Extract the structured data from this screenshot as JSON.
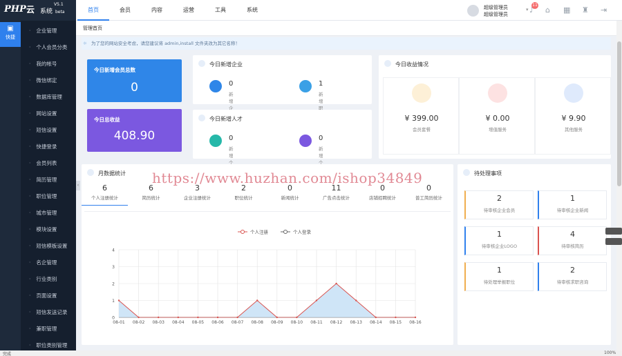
{
  "logo": {
    "php": "PHP",
    "yun": "云",
    "sys": "系统",
    "version": "V5.1",
    "beta": "beta"
  },
  "topnav": [
    "首页",
    "会员",
    "内容",
    "运营",
    "工具",
    "系统"
  ],
  "user": {
    "name": "超级管理员",
    "role": "超级管理员",
    "badge": "11"
  },
  "rail": {
    "label": "快捷"
  },
  "sidebar": [
    "企业管理",
    "个人会员分类",
    "我的帐号",
    "微信绑定",
    "数据库管理",
    "网站设置",
    "短信设置",
    "快捷登录",
    "会员列表",
    "简历管理",
    "职位管理",
    "城市管理",
    "模块设置",
    "短信模板设置",
    "名企管理",
    "行业类别",
    "页面设置",
    "短信发送记录",
    "兼职管理",
    "职位类别管理"
  ],
  "breadcrumb": "管理首页",
  "notice": "为了您的网站安全考虑，请您建议将 admin,install 文件夹改为其它名称！",
  "today_member_total": {
    "label": "今日新增会员总数",
    "value": "0"
  },
  "today_income": {
    "label": "今日总收益",
    "value": "408.90"
  },
  "new_companies": {
    "title": "今日新增企业",
    "items": [
      {
        "value": "0",
        "label": "新增企业会员"
      },
      {
        "value": "1",
        "label": "新增职位"
      }
    ]
  },
  "new_talents": {
    "title": "今日新增人才",
    "items": [
      {
        "value": "0",
        "label": "新增个人会员"
      },
      {
        "value": "0",
        "label": "新增个人简历"
      }
    ]
  },
  "income": {
    "title": "今日收益情况",
    "items": [
      {
        "value": "¥ 399.00",
        "label": "会员套餐"
      },
      {
        "value": "¥ 0.00",
        "label": "增值服务"
      },
      {
        "value": "¥ 9.90",
        "label": "其他服务"
      }
    ]
  },
  "monthly": {
    "title": "月数据统计",
    "tabs": [
      {
        "value": "6",
        "label": "个人注册统计"
      },
      {
        "value": "6",
        "label": "简历统计"
      },
      {
        "value": "3",
        "label": "企业注册统计"
      },
      {
        "value": "2",
        "label": "职位统计"
      },
      {
        "value": "0",
        "label": "新闻统计"
      },
      {
        "value": "11",
        "label": "广告点击统计"
      },
      {
        "value": "0",
        "label": "店铺招聘统计"
      },
      {
        "value": "0",
        "label": "普工简历统计"
      }
    ]
  },
  "todo": {
    "title": "待处理事项",
    "items": [
      {
        "value": "2",
        "label": "待审核企业会员"
      },
      {
        "value": "1",
        "label": "待审核企业新闻"
      },
      {
        "value": "1",
        "label": "待审核企业LOGO"
      },
      {
        "value": "4",
        "label": "待审核简历"
      },
      {
        "value": "1",
        "label": "待处理举报职位"
      },
      {
        "value": "2",
        "label": "待审核求职咨询"
      }
    ]
  },
  "watermark": "https://www.huzhan.com/ishop34849",
  "statusbar": {
    "text": "完成",
    "zoom": "100%"
  },
  "colors": {
    "accent": "#2f80ed",
    "sidebar": "#151f2e",
    "register": "#d9534f",
    "login": "#666666"
  },
  "chart_data": {
    "type": "line",
    "x": [
      "08-01",
      "08-02",
      "08-03",
      "08-04",
      "08-05",
      "08-06",
      "08-07",
      "08-08",
      "08-09",
      "08-10",
      "08-11",
      "08-12",
      "08-13",
      "08-14",
      "08-15",
      "08-16"
    ],
    "series": [
      {
        "name": "个人注册",
        "values": [
          1,
          0,
          0,
          0,
          0,
          0,
          0,
          1,
          0,
          0,
          1,
          2,
          1,
          0,
          0,
          0
        ]
      },
      {
        "name": "个人登录",
        "values": [
          0,
          0,
          0,
          0,
          0,
          0,
          0,
          0,
          0,
          0,
          0,
          0,
          0,
          0,
          0,
          0
        ]
      }
    ],
    "ylim": [
      0,
      4
    ],
    "yticks": [
      0,
      1,
      2,
      3,
      4
    ],
    "grid": true,
    "legend": "top-center",
    "area": true
  }
}
